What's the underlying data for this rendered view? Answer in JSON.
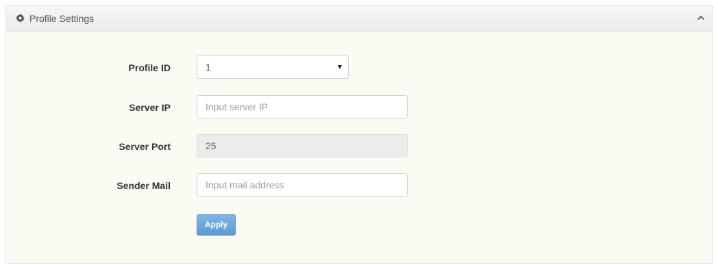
{
  "panel": {
    "title": "Profile Settings",
    "icon": "gear-icon",
    "collapse_icon": "chevron-up-icon"
  },
  "form": {
    "profile_id": {
      "label": "Profile ID",
      "value": "1"
    },
    "server_ip": {
      "label": "Server IP",
      "value": "",
      "placeholder": "Input server IP"
    },
    "server_port": {
      "label": "Server Port",
      "value": "25"
    },
    "sender_mail": {
      "label": "Sender Mail",
      "value": "",
      "placeholder": "Input mail address"
    },
    "apply_label": "Apply"
  },
  "colors": {
    "panel_bg": "#fbfbf4",
    "apply_button": "#6aa8dc"
  }
}
